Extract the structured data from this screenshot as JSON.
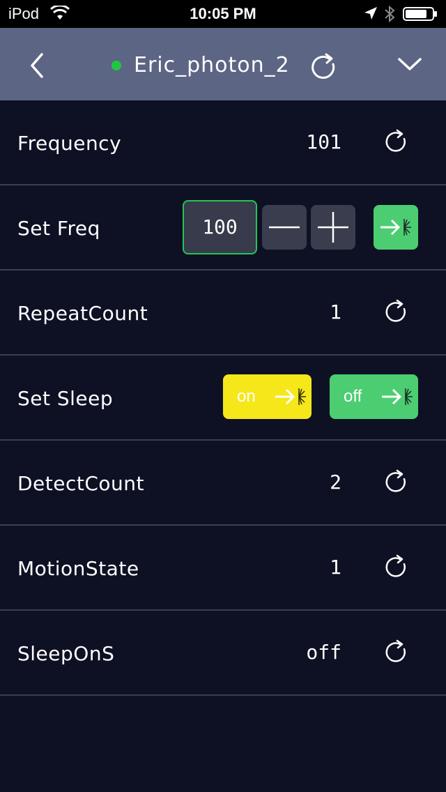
{
  "status_bar": {
    "carrier": "iPod",
    "time": "10:05 PM"
  },
  "header": {
    "device_name": "Eric_photon_2",
    "status_color": "#1ec742"
  },
  "rows": [
    {
      "label": "Frequency",
      "value": "101"
    },
    {
      "label": "Set Freq",
      "input_value": "100"
    },
    {
      "label": "RepeatCount",
      "value": "1"
    },
    {
      "label": "Set Sleep",
      "on_label": "on",
      "off_label": "off"
    },
    {
      "label": "DetectCount",
      "value": "2"
    },
    {
      "label": "MotionState",
      "value": "1"
    },
    {
      "label": "SleepOnS",
      "value": "off"
    }
  ],
  "icons": {
    "back": "chevron-left-icon",
    "refresh": "refresh-icon",
    "menu": "chevron-down-icon",
    "minus": "minus-icon",
    "plus": "plus-icon",
    "send": "send-spark-icon"
  },
  "colors": {
    "background": "#0e1124",
    "header": "#5d6584",
    "accent_green": "#4ccd72",
    "accent_yellow": "#f6e71a"
  }
}
